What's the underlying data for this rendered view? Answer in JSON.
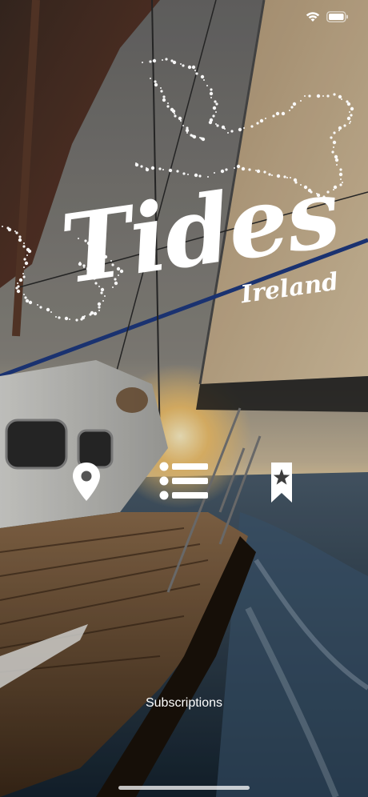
{
  "app": {
    "title": "Tides",
    "subtitle": "Ireland"
  },
  "status_bar": {
    "time": "",
    "wifi_icon": "wifi-icon",
    "battery_icon": "battery-icon"
  },
  "nav": {
    "location_icon": "map-pin-icon",
    "list_icon": "list-icon",
    "favorites_icon": "bookmark-star-icon"
  },
  "footer": {
    "subscriptions_label": "Subscriptions"
  },
  "colors": {
    "text": "#ffffff",
    "sail": "#c8b08a",
    "sea": "#2f4a66",
    "sky": "#6e6a64",
    "rope": "#1e3a80"
  }
}
